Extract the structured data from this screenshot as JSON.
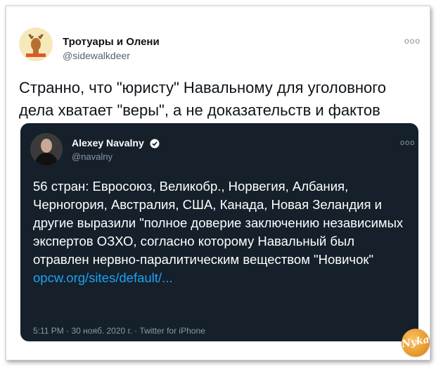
{
  "tweet": {
    "author_name": "Тротуары и Олени",
    "author_handle": "@sidewalkdeer",
    "more_icon": "ooo",
    "text": "Странно, что \"юристу\" Навальному для уголовного дела хватает \"веры\", а не доказательств и фактов"
  },
  "quoted_tweet": {
    "author_name": "Alexey Navalny",
    "author_handle": "@navalny",
    "more_icon": "ooo",
    "text": "56 стран: Евросоюз, Великобр., Норвегия, Албания, Черногория, Австралия, США, Канада, Новая Зеландия и другие выразили \"полное доверие заключению независимых экспертов ОЗХО, согласно которому Навальный был отравлен нервно-паралитическим веществом \"Новичок\"",
    "link": "opcw.org/sites/default/...",
    "meta": "5:11 PM · 30 нояб. 2020 г. · Twitter for iPhone"
  },
  "icons": {
    "verified": "verified-badge-icon",
    "watermark": "site-logo-badge"
  },
  "colors": {
    "quote_bg": "#15202b",
    "link": "#1da1f2",
    "verified": "#ffffff"
  }
}
